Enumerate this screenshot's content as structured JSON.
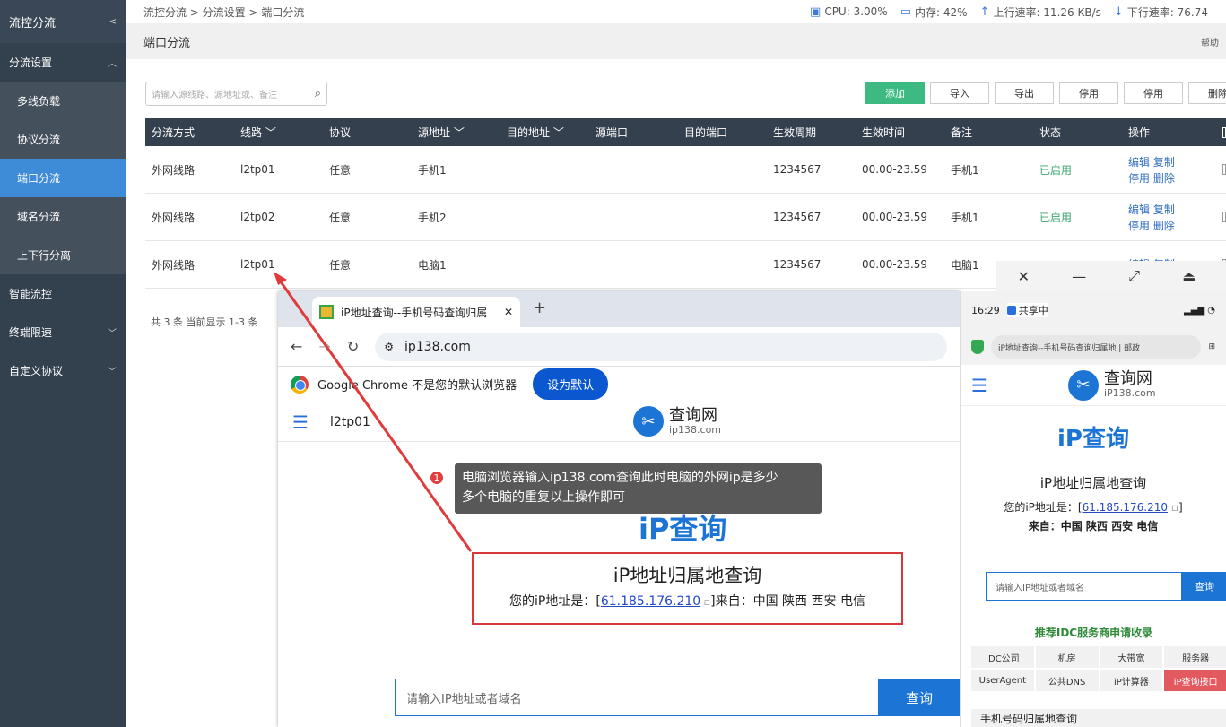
{
  "sidebar": {
    "title": "流控分流",
    "items": [
      {
        "label": "分流设置",
        "type": "group",
        "chevron": "︿"
      },
      {
        "label": "多线负载",
        "type": "sub"
      },
      {
        "label": "协议分流",
        "type": "sub"
      },
      {
        "label": "端口分流",
        "type": "sub",
        "active": true
      },
      {
        "label": "域名分流",
        "type": "sub"
      },
      {
        "label": "上下行分离",
        "type": "sub"
      },
      {
        "label": "智能流控",
        "type": "group",
        "chevron": ""
      },
      {
        "label": "终端限速",
        "type": "group",
        "chevron": "﹀"
      },
      {
        "label": "自定义协议",
        "type": "group",
        "chevron": "﹀"
      }
    ]
  },
  "breadcrumb": "流控分流 > 分流设置 > 端口分流",
  "stats": {
    "cpu": "CPU: 3.00%",
    "mem": "内存: 42%",
    "up": "上行速率: 11.26 KB/s",
    "down": "下行速率: 76.74"
  },
  "page": {
    "title": "端口分流",
    "help": "帮助"
  },
  "search": {
    "placeholder": "请输入源线路、源地址或、备注"
  },
  "actions": [
    "添加",
    "导入",
    "导出",
    "停用",
    "停用",
    "删除"
  ],
  "table": {
    "headers": [
      "分流方式",
      "线路 ﹀",
      "协议",
      "源地址 ﹀",
      "目的地址 ﹀",
      "源端口",
      "目的端口",
      "生效周期",
      "生效时间",
      "备注",
      "状态",
      "操作"
    ],
    "rows": [
      {
        "cells": [
          "外网线路",
          "l2tp01",
          "任意",
          "手机1",
          "",
          "",
          "",
          "1234567",
          "00.00-23.59",
          "手机1",
          "已启用"
        ],
        "ops": [
          "编辑 复制",
          "停用 删除"
        ]
      },
      {
        "cells": [
          "外网线路",
          "l2tp02",
          "任意",
          "手机2",
          "",
          "",
          "",
          "1234567",
          "00.00-23.59",
          "手机1",
          "已启用"
        ],
        "ops": [
          "编辑 复制",
          "停用 删除"
        ]
      },
      {
        "cells": [
          "外网线路",
          "l2tp01",
          "任意",
          "电脑1",
          "",
          "",
          "",
          "1234567",
          "00.00-23.59",
          "电脑1",
          ""
        ],
        "ops": [
          "编辑 复制",
          ""
        ]
      }
    ]
  },
  "count": "共 3 条 当前显示 1-3 条",
  "browser": {
    "tab_title": "iP地址查询--手机号码查询归属",
    "url": "ip138.com",
    "info_text": "Google Chrome 不是您的默认浏览器",
    "set_default": "设为默认",
    "nav_label": "l2tp01",
    "logo_title": "查询网",
    "logo_sub": "ip138.com",
    "big_title": "iP查询",
    "box_title": "iP地址归属地查询",
    "ip_prefix": "您的iP地址是：[",
    "ip": "61.185.176.210",
    "ip_suffix": "]来自：中国 陕西 西安 电信",
    "query_placeholder": "请输入IP地址或者域名",
    "query_button": "查询"
  },
  "tooltip": {
    "badge": "1",
    "line1": "电脑浏览器输入ip138.com查询此时电脑的外网ip是多少",
    "line2": "多个电脑的重复以上操作即可"
  },
  "phone": {
    "window_controls": [
      "✕",
      "—",
      "⤢",
      "⏏"
    ],
    "time": "16:29",
    "share": "共享中",
    "url": "iP地址查询--手机号码查询归属地 | 邮政",
    "logo_title": "查询网",
    "logo_sub": "iP138.com",
    "big_title": "iP查询",
    "sub_title": "iP地址归属地查询",
    "ip_prefix": "您的iP地址是：[",
    "ip": "61.185.176.210",
    "ip_suffix": "]",
    "from": "来自：中国 陕西 西安 电信",
    "query_placeholder": "请输入IP地址或者域名",
    "query_button": "查询",
    "ads_title": "推荐IDC服务商申请收录",
    "grid": [
      "IDC公司",
      "机房",
      "大带宽",
      "服务器",
      "UserAgent",
      "公共DNS",
      "iP计算器",
      "iP查询接口"
    ],
    "footer": "手机号码归属地查询"
  },
  "colors": {
    "sidebar": "#33404e",
    "active": "#3e8bd8",
    "primary": "#3cba82",
    "accent": "#1c74d4",
    "alert": "#d9373b"
  }
}
